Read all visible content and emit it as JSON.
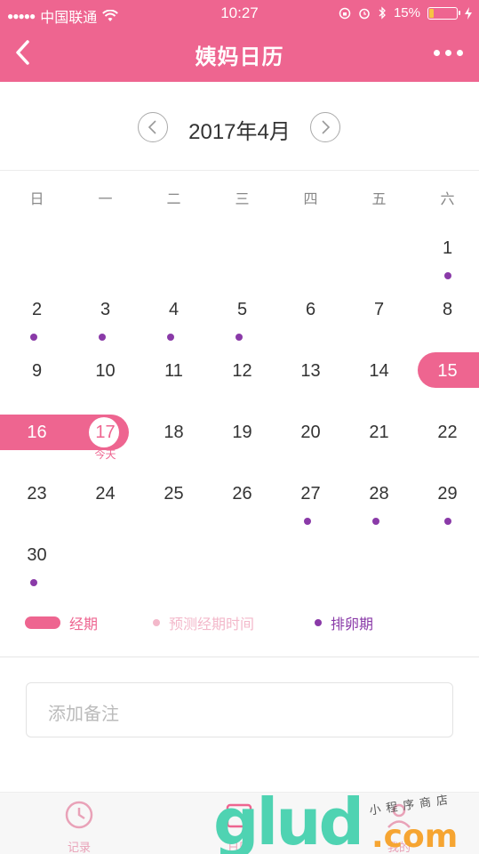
{
  "status_bar": {
    "carrier": "中国联通",
    "time": "10:27",
    "battery": "15%"
  },
  "nav": {
    "title": "姨妈日历"
  },
  "calendar": {
    "month_label": "2017年4月",
    "weekdays": [
      "日",
      "一",
      "二",
      "三",
      "四",
      "五",
      "六"
    ],
    "days": [
      {
        "d": "1",
        "col": 6,
        "row": 0,
        "ovulation": true
      },
      {
        "d": "2",
        "col": 0,
        "row": 1,
        "ovulation": true
      },
      {
        "d": "3",
        "col": 1,
        "row": 1,
        "ovulation": true
      },
      {
        "d": "4",
        "col": 2,
        "row": 1,
        "ovulation": true
      },
      {
        "d": "5",
        "col": 3,
        "row": 1,
        "ovulation": true
      },
      {
        "d": "6",
        "col": 4,
        "row": 1
      },
      {
        "d": "7",
        "col": 5,
        "row": 1
      },
      {
        "d": "8",
        "col": 6,
        "row": 1
      },
      {
        "d": "9",
        "col": 0,
        "row": 2
      },
      {
        "d": "10",
        "col": 1,
        "row": 2
      },
      {
        "d": "11",
        "col": 2,
        "row": 2
      },
      {
        "d": "12",
        "col": 3,
        "row": 2
      },
      {
        "d": "13",
        "col": 4,
        "row": 2
      },
      {
        "d": "14",
        "col": 5,
        "row": 2
      },
      {
        "d": "15",
        "col": 6,
        "row": 2,
        "period": true
      },
      {
        "d": "16",
        "col": 0,
        "row": 3,
        "period": true
      },
      {
        "d": "17",
        "col": 1,
        "row": 3,
        "period": true,
        "today": true
      },
      {
        "d": "18",
        "col": 2,
        "row": 3
      },
      {
        "d": "19",
        "col": 3,
        "row": 3
      },
      {
        "d": "20",
        "col": 4,
        "row": 3
      },
      {
        "d": "21",
        "col": 5,
        "row": 3
      },
      {
        "d": "22",
        "col": 6,
        "row": 3
      },
      {
        "d": "23",
        "col": 0,
        "row": 4
      },
      {
        "d": "24",
        "col": 1,
        "row": 4
      },
      {
        "d": "25",
        "col": 2,
        "row": 4
      },
      {
        "d": "26",
        "col": 3,
        "row": 4
      },
      {
        "d": "27",
        "col": 4,
        "row": 4,
        "ovulation": true
      },
      {
        "d": "28",
        "col": 5,
        "row": 4,
        "ovulation": true
      },
      {
        "d": "29",
        "col": 6,
        "row": 4,
        "ovulation": true
      },
      {
        "d": "30",
        "col": 0,
        "row": 5,
        "ovulation": true
      }
    ],
    "today_label": "今天"
  },
  "legend": {
    "period": "经期",
    "predicted": "预测经期时间",
    "ovulation": "排卵期"
  },
  "note": {
    "placeholder": "添加备注"
  },
  "tabbar": {
    "items": [
      {
        "label": "记录"
      },
      {
        "label": "日历"
      },
      {
        "label": "我的"
      }
    ]
  },
  "watermark": {
    "brand": "glud",
    "suffix": ".com",
    "tagline": "小程序商店"
  },
  "colors": {
    "primary": "#ee6590",
    "ovulation": "#8a3aa8",
    "predicted": "#f3b8ca"
  }
}
